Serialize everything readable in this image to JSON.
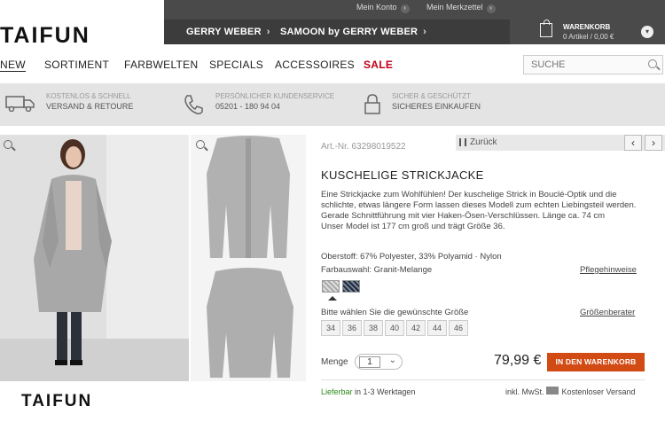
{
  "header": {
    "logo": "TAIFUN",
    "top_links": [
      "Mein Konto",
      "Mein Merkzettel"
    ],
    "brand_tabs": [
      "GERRY WEBER",
      "SAMOON by GERRY WEBER"
    ],
    "cart": {
      "title": "WARENKORB",
      "summary": "0 Artikel / 0,00 €"
    }
  },
  "nav": {
    "items": [
      "NEW",
      "SORTIMENT",
      "FARBWELTEN",
      "SPECIALS",
      "ACCESSOIRES",
      "SALE"
    ],
    "search_placeholder": "SUCHE"
  },
  "services": [
    {
      "line1": "KOSTENLOS & SCHNELL",
      "line2": "VERSAND & RETOURE"
    },
    {
      "line1": "PERSÖNLICHER KUNDENSERVICE",
      "line2": "05201 - 180 94 04"
    },
    {
      "line1": "SICHER & GESCHÜTZT",
      "line2": "SICHERES EINKAUFEN"
    }
  ],
  "product": {
    "art_nr": "Art.-Nr. 63298019522",
    "back_label": "Zurück",
    "title": "KUSCHELIGE STRICKJACKE",
    "description": "Eine Strickjacke zum Wohlfühlen! Der kuschelige Strick in Bouclé-Optik und die schlichte, etwas längere Form lassen dieses Modell zum echten Liebingsteil werden. Gerade Schnittführung mit vier Haken-Ösen-Verschlüssen. Länge ca. 74 cm",
    "model_info": "Unser Model ist 177 cm groß und trägt Größe 36.",
    "material": "Oberstoff: 67% Polyester, 33% Polyamid · Nylon",
    "color_label": "Farbauswahl: Granit-Melange",
    "care_link": "Pflegehinweise",
    "size_prompt": "Bitte wählen Sie die gewünschte Größe",
    "size_chart_link": "Größenberater",
    "sizes": [
      "34",
      "36",
      "38",
      "40",
      "42",
      "44",
      "46"
    ],
    "quantity_label": "Menge",
    "quantity": "1",
    "price": "79,99 €",
    "cart_button": "IN DEN WARENKORB",
    "delivery_prefix": "Lieferbar",
    "delivery_suffix": " in 1-3 Werktagen",
    "shipping_note": "inkl. MwSt.        Kostenloser Versand"
  },
  "bottom_logo": "TAIFUN"
}
